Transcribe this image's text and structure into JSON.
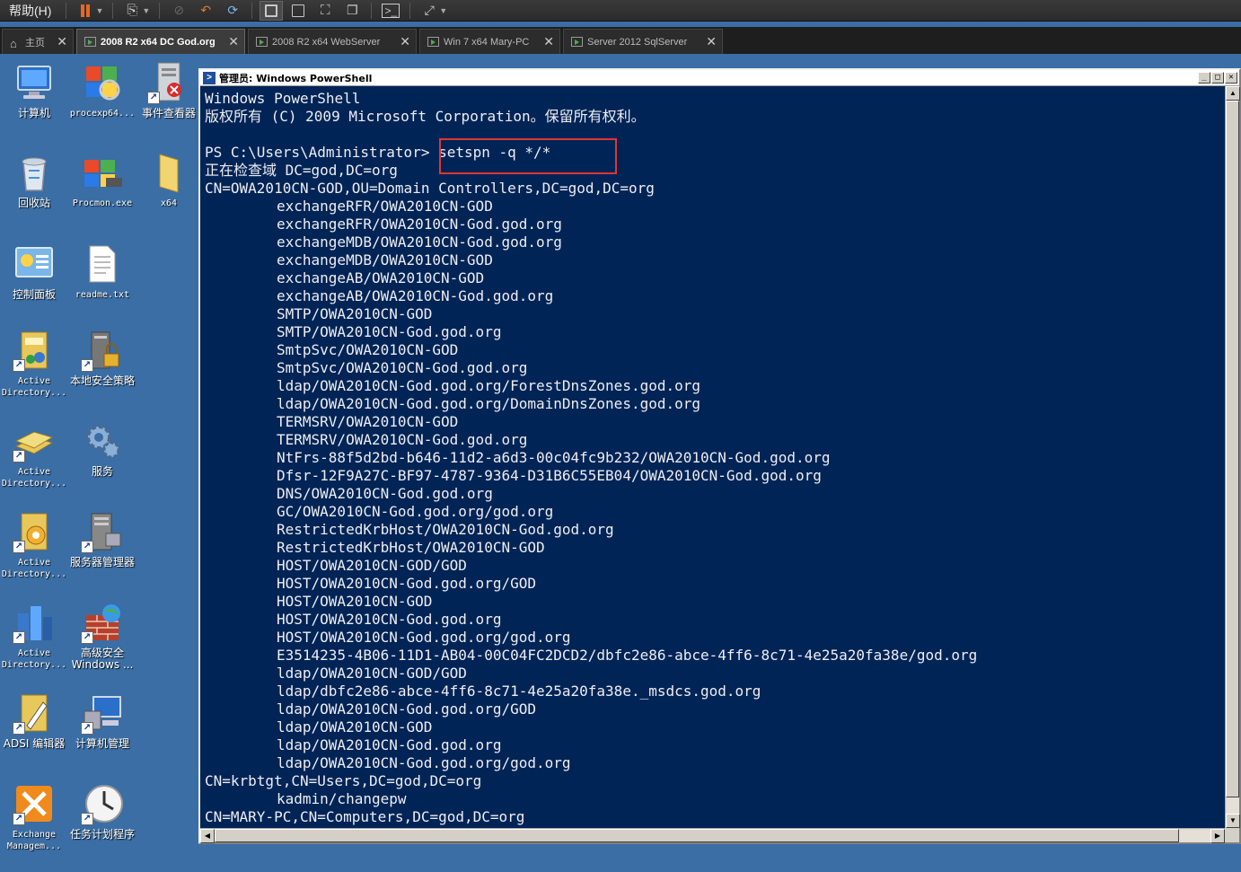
{
  "toolbar": {
    "help_menu": "帮助(H)"
  },
  "tabs": [
    {
      "label": "主页",
      "active": false,
      "type": "home"
    },
    {
      "label": "2008 R2 x64 DC God.org",
      "active": true
    },
    {
      "label": "2008 R2 x64 WebServer",
      "active": false
    },
    {
      "label": "Win 7 x64 Mary-PC",
      "active": false
    },
    {
      "label": "Server 2012 SqlServer",
      "active": false
    }
  ],
  "desktop_icons": [
    {
      "label": "计算机",
      "icon": "computer-icon"
    },
    {
      "label": "procexp64...",
      "icon": "process-explorer-icon"
    },
    {
      "label": "事件查看器",
      "icon": "event-viewer-icon"
    },
    {
      "label": "回收站",
      "icon": "recycle-bin-icon"
    },
    {
      "label": "Procmon.exe",
      "icon": "procmon-icon"
    },
    {
      "label": "x64",
      "icon": "folder-icon"
    },
    {
      "label": "控制面板",
      "icon": "control-panel-icon"
    },
    {
      "label": "readme.txt",
      "icon": "text-file-icon"
    },
    {
      "label": "Active Directory...",
      "icon": "ad-users-icon"
    },
    {
      "label": "本地安全策略",
      "icon": "local-security-icon"
    },
    {
      "label": "Active Directory...",
      "icon": "ad-domains-icon"
    },
    {
      "label": "服务",
      "icon": "services-icon"
    },
    {
      "label": "Active Directory...",
      "icon": "ad-sites-icon"
    },
    {
      "label": "服务器管理器",
      "icon": "server-manager-icon"
    },
    {
      "label": "Active Directory...",
      "icon": "ad-admin-center-icon"
    },
    {
      "label": "高级安全 Windows ...",
      "icon": "firewall-icon"
    },
    {
      "label": "ADSI 编辑器",
      "icon": "adsi-edit-icon"
    },
    {
      "label": "计算机管理",
      "icon": "computer-management-icon"
    },
    {
      "label": "Exchange Managem...",
      "icon": "exchange-icon"
    },
    {
      "label": "任务计划程序",
      "icon": "task-scheduler-icon"
    }
  ],
  "powershell": {
    "title": "管理员: Windows PowerShell",
    "lines": [
      {
        "text": "Windows PowerShell",
        "indent": false
      },
      {
        "text": "版权所有 (C) 2009 Microsoft Corporation。保留所有权利。",
        "indent": false
      },
      {
        "text": "",
        "indent": false
      },
      {
        "text": "PS C:\\Users\\Administrator> setspn -q */*",
        "indent": false
      },
      {
        "text": "正在检查域 DC=god,DC=org",
        "indent": false
      },
      {
        "text": "CN=OWA2010CN-GOD,OU=Domain Controllers,DC=god,DC=org",
        "indent": false
      },
      {
        "text": "exchangeRFR/OWA2010CN-GOD",
        "indent": true
      },
      {
        "text": "exchangeRFR/OWA2010CN-God.god.org",
        "indent": true
      },
      {
        "text": "exchangeMDB/OWA2010CN-God.god.org",
        "indent": true
      },
      {
        "text": "exchangeMDB/OWA2010CN-GOD",
        "indent": true
      },
      {
        "text": "exchangeAB/OWA2010CN-GOD",
        "indent": true
      },
      {
        "text": "exchangeAB/OWA2010CN-God.god.org",
        "indent": true
      },
      {
        "text": "SMTP/OWA2010CN-GOD",
        "indent": true
      },
      {
        "text": "SMTP/OWA2010CN-God.god.org",
        "indent": true
      },
      {
        "text": "SmtpSvc/OWA2010CN-GOD",
        "indent": true
      },
      {
        "text": "SmtpSvc/OWA2010CN-God.god.org",
        "indent": true
      },
      {
        "text": "ldap/OWA2010CN-God.god.org/ForestDnsZones.god.org",
        "indent": true
      },
      {
        "text": "ldap/OWA2010CN-God.god.org/DomainDnsZones.god.org",
        "indent": true
      },
      {
        "text": "TERMSRV/OWA2010CN-GOD",
        "indent": true
      },
      {
        "text": "TERMSRV/OWA2010CN-God.god.org",
        "indent": true
      },
      {
        "text": "NtFrs-88f5d2bd-b646-11d2-a6d3-00c04fc9b232/OWA2010CN-God.god.org",
        "indent": true
      },
      {
        "text": "Dfsr-12F9A27C-BF97-4787-9364-D31B6C55EB04/OWA2010CN-God.god.org",
        "indent": true
      },
      {
        "text": "DNS/OWA2010CN-God.god.org",
        "indent": true
      },
      {
        "text": "GC/OWA2010CN-God.god.org/god.org",
        "indent": true
      },
      {
        "text": "RestrictedKrbHost/OWA2010CN-God.god.org",
        "indent": true
      },
      {
        "text": "RestrictedKrbHost/OWA2010CN-GOD",
        "indent": true
      },
      {
        "text": "HOST/OWA2010CN-GOD/GOD",
        "indent": true
      },
      {
        "text": "HOST/OWA2010CN-God.god.org/GOD",
        "indent": true
      },
      {
        "text": "HOST/OWA2010CN-GOD",
        "indent": true
      },
      {
        "text": "HOST/OWA2010CN-God.god.org",
        "indent": true
      },
      {
        "text": "HOST/OWA2010CN-God.god.org/god.org",
        "indent": true
      },
      {
        "text": "E3514235-4B06-11D1-AB04-00C04FC2DCD2/dbfc2e86-abce-4ff6-8c71-4e25a20fa38e/god.org",
        "indent": true
      },
      {
        "text": "ldap/OWA2010CN-GOD/GOD",
        "indent": true
      },
      {
        "text": "ldap/dbfc2e86-abce-4ff6-8c71-4e25a20fa38e._msdcs.god.org",
        "indent": true
      },
      {
        "text": "ldap/OWA2010CN-God.god.org/GOD",
        "indent": true
      },
      {
        "text": "ldap/OWA2010CN-GOD",
        "indent": true
      },
      {
        "text": "ldap/OWA2010CN-God.god.org",
        "indent": true
      },
      {
        "text": "ldap/OWA2010CN-God.god.org/god.org",
        "indent": true
      },
      {
        "text": "CN=krbtgt,CN=Users,DC=god,DC=org",
        "indent": false
      },
      {
        "text": "kadmin/changepw",
        "indent": true
      },
      {
        "text": "CN=MARY-PC,CN=Computers,DC=god,DC=org",
        "indent": false
      }
    ],
    "colors": {
      "background": "#012456",
      "foreground": "#eeedf0",
      "highlight": "#e03434"
    }
  }
}
